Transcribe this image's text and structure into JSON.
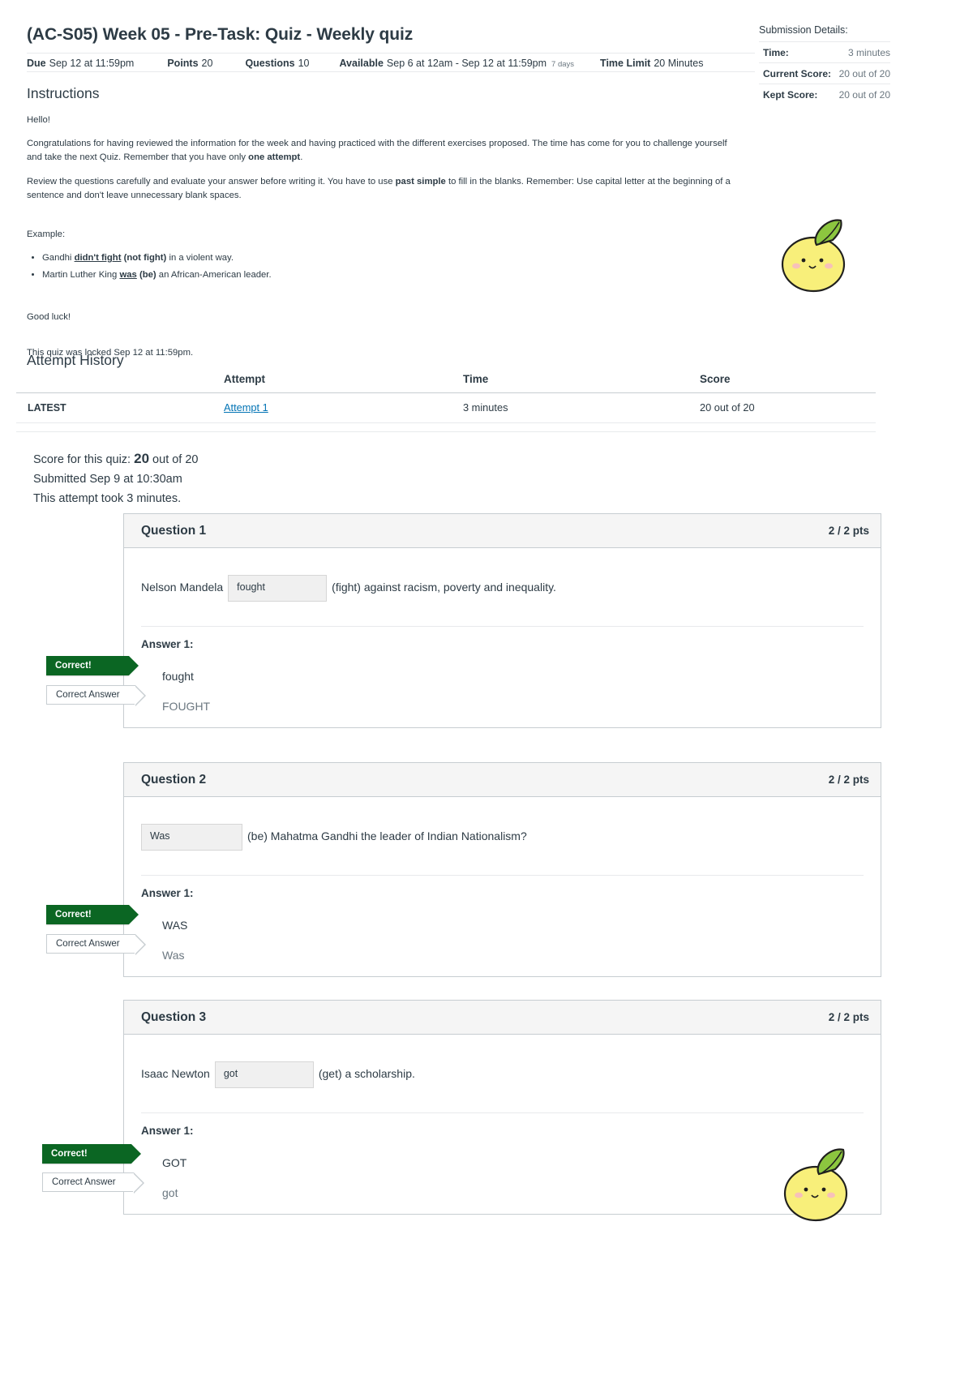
{
  "header": {
    "title": "(AC-S05) Week 05 - Pre-Task: Quiz - Weekly quiz",
    "details": [
      {
        "label": "Due",
        "value": "Sep 12 at 11:59pm",
        "sub": ""
      },
      {
        "label": "Points",
        "value": "20",
        "sub": ""
      },
      {
        "label": "Questions",
        "value": "10",
        "sub": ""
      },
      {
        "label": "Available",
        "value": "Sep 6 at 12am - Sep 12 at 11:59pm",
        "sub": "7 days"
      },
      {
        "label": "Time Limit",
        "value": "20 Minutes",
        "sub": ""
      }
    ]
  },
  "submission_details": {
    "title": "Submission Details:",
    "rows": [
      {
        "key": "Time:",
        "value": "3 minutes"
      },
      {
        "key": "Current Score:",
        "value": "20 out of 20"
      },
      {
        "key": "Kept Score:",
        "value": "20 out of 20"
      }
    ]
  },
  "instructions": {
    "heading": "Instructions",
    "greeting": "Hello!",
    "para1_a": "Congratulations for having reviewed the information for the week and having practiced with the different exercises proposed. The time has come for you to challenge yourself and take the next Quiz. Remember that you have only ",
    "para1_bold": "one attempt",
    "para1_b": ".",
    "para2_a": "Review the questions carefully and evaluate your answer before writing it. You have to use ",
    "para2_bold": "past simple",
    "para2_b": " to fill in the blanks. Remember: Use capital letter at the beginning of a sentence and don't leave unnecessary blank spaces.",
    "example_label": "Example:",
    "examples": [
      {
        "pre": "Gandhi ",
        "underline": "didn't  fight",
        "bold": " (not fight)",
        "post": " in a violent way."
      },
      {
        "pre": "Martin Luther King ",
        "underline": "was",
        "bold": " (be)",
        "post": " an African-American leader."
      }
    ],
    "good_luck": "Good luck!",
    "locked_note": "This quiz was locked Sep 12 at 11:59pm."
  },
  "attempt_history": {
    "heading": "Attempt History",
    "columns": [
      "",
      "Attempt",
      "Time",
      "Score"
    ],
    "rows": [
      {
        "flag": "LATEST",
        "attempt": "Attempt 1",
        "time": "3 minutes",
        "score": "20 out of 20"
      }
    ]
  },
  "score_summary": {
    "line1_pre": "Score for this quiz: ",
    "line1_big": "20",
    "line1_post": " out of 20",
    "line2": "Submitted Sep 9 at 10:30am",
    "line3": "This attempt took 3 minutes."
  },
  "questions": [
    {
      "title": "Question 1",
      "points": "2 / 2 pts",
      "prefix": "Nelson Mandela",
      "blank_value": "fought",
      "suffix": "(fight) against racism, poverty and inequality.",
      "blank_first": false,
      "answer_label": "Answer 1:",
      "student_answer": "fought",
      "correct_answer": "FOUGHT",
      "correct_flag": "Correct!",
      "correct_answer_flag": "Correct Answer"
    },
    {
      "title": "Question 2",
      "points": "2 / 2 pts",
      "prefix": "",
      "blank_value": "Was",
      "suffix": "(be) Mahatma Gandhi the leader of Indian Nationalism?",
      "blank_first": true,
      "answer_label": "Answer 1:",
      "student_answer": "WAS",
      "correct_answer": "Was",
      "correct_flag": "Correct!",
      "correct_answer_flag": "Correct Answer"
    },
    {
      "title": "Question 3",
      "points": "2 / 2 pts",
      "prefix": "Isaac Newton",
      "blank_value": "got",
      "suffix": "(get) a scholarship.",
      "blank_first": false,
      "answer_label": "Answer 1:",
      "student_answer": "GOT",
      "correct_answer": "got",
      "correct_flag": "Correct!",
      "correct_answer_flag": "Correct Answer"
    }
  ],
  "colors": {
    "correct_green": "#0b6623",
    "link_blue": "#0374b5",
    "text": "#2d3b45",
    "muted": "#6b7780",
    "border": "#c7cdd1",
    "header_bg": "#f5f5f5",
    "blank_bg": "#f0f0f0",
    "lemon_yellow": "#f7e96a",
    "lemon_leaf": "#8cc63f"
  }
}
